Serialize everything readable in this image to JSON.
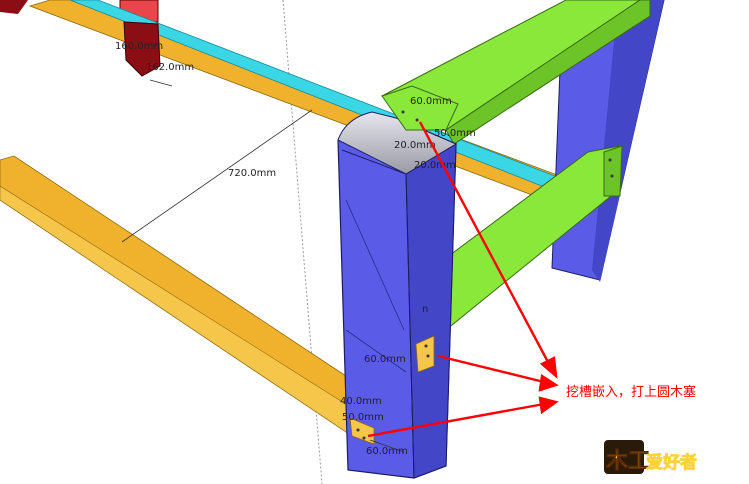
{
  "colors": {
    "leg": "#5a5ce8",
    "leg_dark": "#4446c8",
    "leg_outline": "#1c1c66",
    "rail_green": "#8ae83a",
    "rail_green_dark": "#6cc428",
    "beam_yellow": "#f0b22c",
    "beam_yellow_light": "#f6c64a",
    "strip_cyan": "#3ad6e6",
    "red_block": "#e8464a",
    "dark_red": "#8a0e14",
    "annotation": "#ff0000"
  },
  "dimensions": {
    "d1": "160.0mm",
    "d2": "162.0mm",
    "d3": "720.0mm",
    "d4": "60.0mm",
    "d5": "50.0mm",
    "d6": "20.0mm",
    "d7": "20.0mm",
    "d8": "60.0mm",
    "d9": "40.0mm",
    "d10": "50.0mm",
    "d11": "60.0mm",
    "small_n": "n"
  },
  "annotation": {
    "text": "挖槽嵌入，打上圆木塞"
  },
  "logo": {
    "mark": "木工",
    "text": "爱好者",
    "icon": "woodworker-logo-icon"
  }
}
